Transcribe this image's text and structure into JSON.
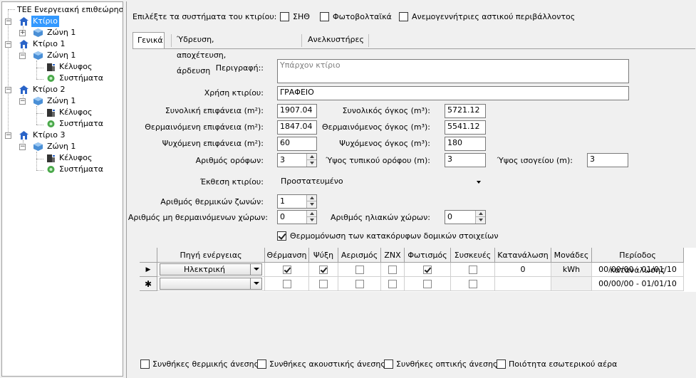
{
  "tree": {
    "root": "ΤΕΕ Ενεργειακή επιθεώρηση",
    "nodes": [
      {
        "label": "Κτίριο",
        "selected": true
      },
      {
        "label": "Ζώνη 1"
      },
      {
        "label": "Κτίριο 1"
      },
      {
        "label": "Ζώνη 1"
      },
      {
        "label": "Κέλυφος"
      },
      {
        "label": "Συστήματα"
      },
      {
        "label": "Κτίριο 2"
      },
      {
        "label": "Ζώνη 1"
      },
      {
        "label": "Κέλυφος"
      },
      {
        "label": "Συστήματα"
      },
      {
        "label": "Κτίριο 3"
      },
      {
        "label": "Ζώνη 1"
      },
      {
        "label": "Κέλυφος"
      },
      {
        "label": "Συστήματα"
      }
    ]
  },
  "systems": {
    "prompt": "Επιλέξτε τα συστήματα του κτιρίου:",
    "options": [
      {
        "label": "ΣΗΘ",
        "checked": false
      },
      {
        "label": "Φωτοβολταϊκά",
        "checked": false
      },
      {
        "label": "Ανεμογεννήτριες αστικού περιβάλλοντος",
        "checked": false
      }
    ]
  },
  "tabs": [
    "Γενικά",
    "Ύδρευση, αποχέτευση, άρδευση",
    "Ανελκυστήρες"
  ],
  "form": {
    "description_label": "Περιγραφή::",
    "description_placeholder": "Υπάρχον κτίριο",
    "use_label": "Χρήση κτιρίου:",
    "use_value": "ΓΡΑΦΕΙΟ",
    "total_area_label": "Συνολική επιφάνεια (m²):",
    "total_area": "1907.04",
    "total_volume_label": "Συνολικός όγκος (m³):",
    "total_volume": "5721.12",
    "heated_area_label": "Θερμαινόμενη επιφάνεια (m²):",
    "heated_area": "1847.04",
    "heated_volume_label": "Θερμαινόμενος όγκος (m³):",
    "heated_volume": "5541.12",
    "cooled_area_label": "Ψυχόμενη επιφάνεια (m²):",
    "cooled_area": "60",
    "cooled_volume_label": "Ψυχόμενος όγκος (m³):",
    "cooled_volume": "180",
    "floors_label": "Αριθμός ορόφων:",
    "floors": "3",
    "floor_height_label": "Ύψος τυπικού ορόφου (m):",
    "floor_height": "3",
    "ground_height_label": "Ύψος ισογείου (m):",
    "ground_height": "3",
    "exposure_label": "Έκθεση κτιρίου:",
    "exposure_value": "Προστατευμένο",
    "thermal_zones_label": "Αριθμός θερμικών ζωνών:",
    "thermal_zones": "1",
    "unheated_label": "Αριθμός μη θερμαινόμενων χώρων:",
    "unheated": "0",
    "solar_label": "Αριθμός ηλιακών χώρων:",
    "solar": "0",
    "insulation_label": "Θερμομόνωση των  κατακόρυφων δομικών στοιχείων",
    "insulation_checked": true
  },
  "grid": {
    "columns": [
      "Πηγή ενέργειας",
      "Θέρμανση",
      "Ψύξη",
      "Αερισμός",
      "ΖΝΧ",
      "Φωτισμός",
      "Συσκευές",
      "Κατανάλωση",
      "Μονάδες",
      "Περίοδος κατανάλωσης"
    ],
    "rows": [
      {
        "marker": "▶",
        "source": "Ηλεκτρική",
        "checks": [
          true,
          true,
          false,
          false,
          true,
          false
        ],
        "consumption": "0",
        "units": "kWh",
        "period": "00/00/00 - 01/01/10"
      },
      {
        "marker": "✱",
        "source": "",
        "checks": [
          false,
          false,
          false,
          false,
          false,
          false
        ],
        "consumption": "",
        "units": "",
        "period": "00/00/00 - 01/01/10"
      }
    ]
  },
  "comfort": [
    "Συνθήκες θερμικής άνεσης",
    "Συνθήκες ακουστικής άνεσης",
    "Συνθήκες οπτικής άνεσης",
    "Ποιότητα εσωτερικού αέρα"
  ]
}
